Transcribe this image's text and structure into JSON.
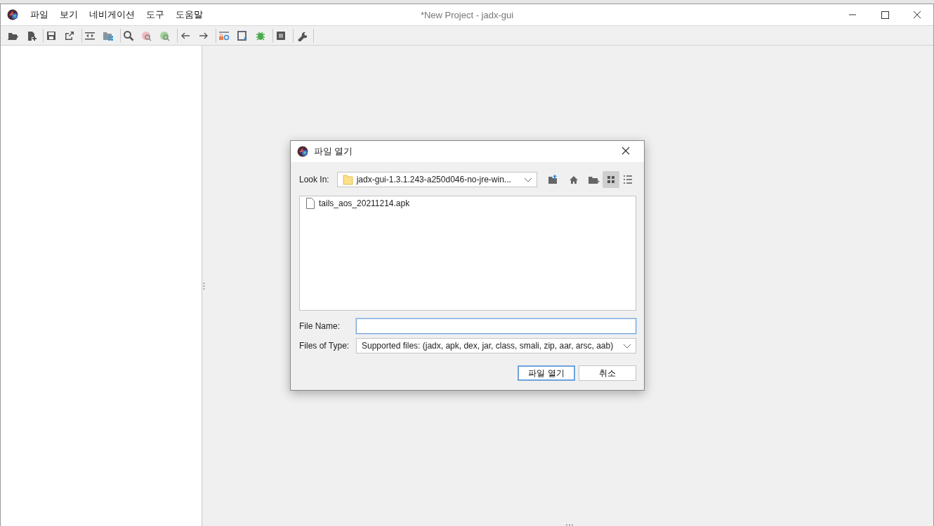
{
  "window": {
    "title": "*New Project - jadx-gui"
  },
  "menu": [
    {
      "label": "파일"
    },
    {
      "label": "보기"
    },
    {
      "label": "네비게이션"
    },
    {
      "label": "도구"
    },
    {
      "label": "도움말"
    }
  ],
  "dialog": {
    "title": "파일 열기",
    "look_in": {
      "label": "Look In:",
      "value": "jadx-gui-1.3.1.243-a250d046-no-jre-win..."
    },
    "view_modes": [
      {
        "selected": true
      },
      {
        "selected": false
      }
    ],
    "files": [
      {
        "name": "tails_aos_20211214.apk"
      }
    ],
    "file_name": {
      "label": "File Name:"
    },
    "file_type": {
      "label": "Files of Type:",
      "value": "Supported files: (jadx, apk, dex, jar, class, smali, zip, aar, arsc, aab)"
    },
    "buttons": [
      {
        "label": "파일 열기",
        "default": true
      },
      {
        "label": "취소",
        "default": false
      }
    ]
  }
}
